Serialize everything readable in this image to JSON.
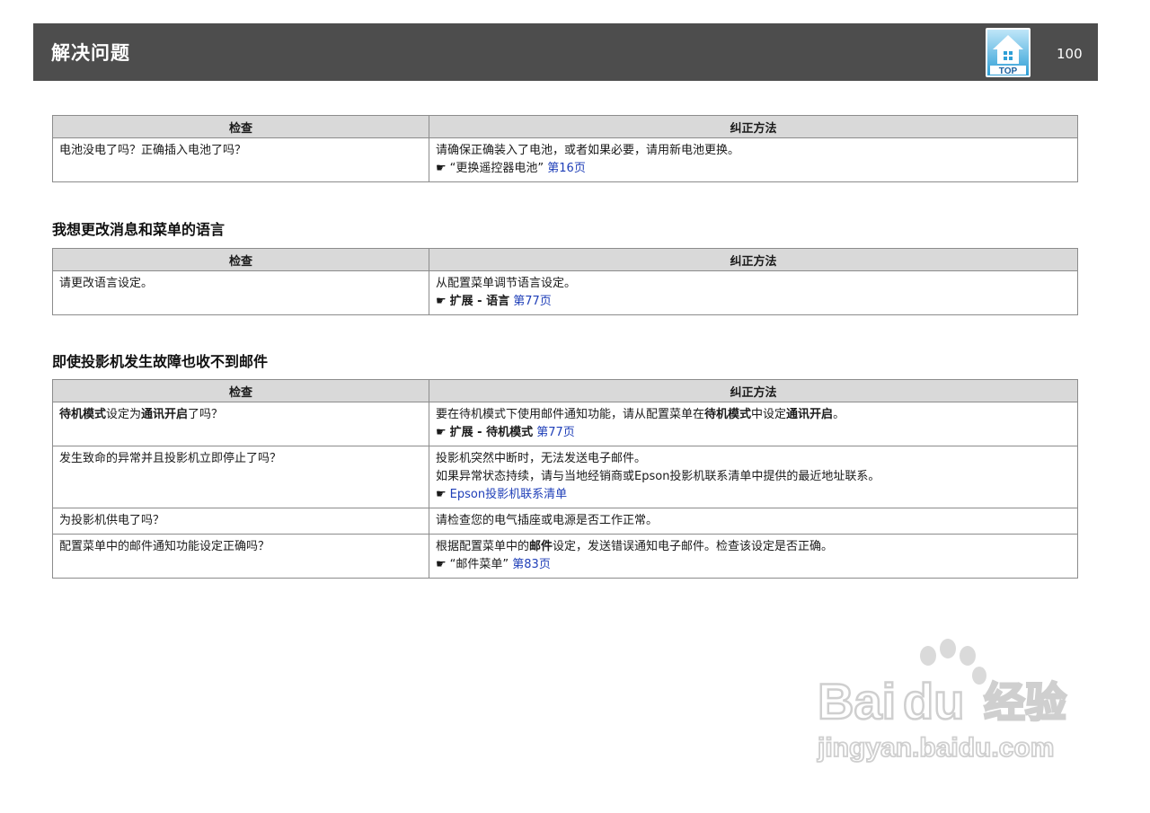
{
  "header": {
    "title": "解决问题",
    "page_number": "100",
    "top_label": "TOP"
  },
  "common": {
    "col_check": "检查",
    "col_fix": "纠正方法"
  },
  "table1": {
    "row1": {
      "check": "电池没电了吗？正确插入电池了吗？",
      "fix_line1": "请确保正确装入了电池，或者如果必要，请用新电池更换。",
      "ref_text": "“更换遥控器电池”",
      "ref_link": "第16页"
    }
  },
  "section2": {
    "title": "我想更改消息和菜单的语言",
    "row1": {
      "check": "请更改语言设定。",
      "fix_line1": "从配置菜单调节语言设定。",
      "ref_text": "扩展 - 语言",
      "ref_link": "第77页"
    }
  },
  "section3": {
    "title": "即使投影机发生故障也收不到邮件",
    "row1": {
      "check_b1": "待机模式",
      "check_t1": "设定为",
      "check_b2": "通讯开启",
      "check_t2": "了吗？",
      "fix_t1": "要在待机模式下使用邮件通知功能，请从配置菜单在",
      "fix_b1": "待机模式",
      "fix_t2": "中设定",
      "fix_b2": "通讯开启",
      "fix_t3": "。",
      "ref_text": "扩展 - 待机模式",
      "ref_link": "第77页"
    },
    "row2": {
      "check": "发生致命的异常并且投影机立即停止了吗？",
      "fix_line1": "投影机突然中断时，无法发送电子邮件。",
      "fix_line2": "如果异常状态持续，请与当地经销商或Epson投影机联系清单中提供的最近地址联系。",
      "ref_link": "Epson投影机联系清单"
    },
    "row3": {
      "check": "为投影机供电了吗？",
      "fix_line1": "请检查您的电气插座或电源是否工作正常。"
    },
    "row4": {
      "check": "配置菜单中的邮件通知功能设定正确吗？",
      "fix_t1": "根据配置菜单中的",
      "fix_b1": "邮件",
      "fix_t2": "设定，发送错误通知电子邮件。检查该设定是否正确。",
      "ref_text": "“邮件菜单”",
      "ref_link": "第83页"
    }
  },
  "watermark": {
    "brand": "Bai",
    "brand2": "du",
    "brand_cn": "经验",
    "url": "jingyan.baidu.com"
  },
  "icons": {
    "pointer": "pointing-hand-icon",
    "top": "house-top-icon",
    "paw": "paw-icon"
  },
  "colors": {
    "header_bg": "#4d4d4d",
    "table_header_bg": "#d9d9d9",
    "link": "#1f3fb8"
  }
}
